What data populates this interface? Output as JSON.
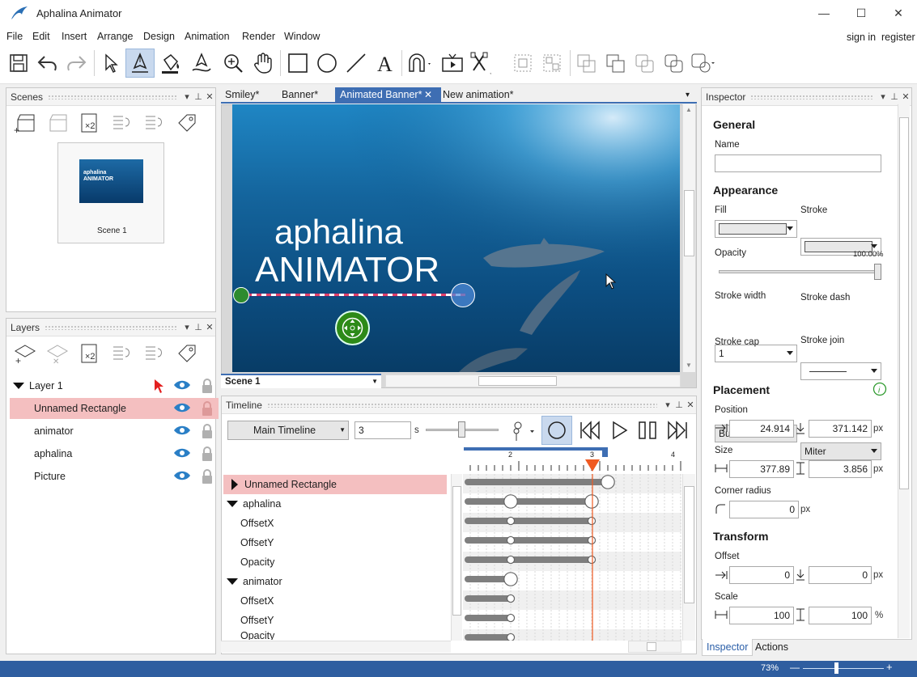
{
  "window": {
    "title": "Aphalina Animator",
    "minimize": "—",
    "maximize": "☐",
    "close": "✕"
  },
  "menu": [
    "File",
    "Edit",
    "Insert",
    "Arrange",
    "Design",
    "Animation",
    "Render",
    "Window"
  ],
  "account": {
    "sign_in": "sign in",
    "register": "register"
  },
  "toolbar": {
    "tools": [
      "save-icon",
      "undo-icon",
      "redo-icon",
      "pointer-icon",
      "pen-tool-icon",
      "fill-bucket-icon",
      "stroke-pen-icon",
      "zoom-icon",
      "hand-icon",
      "rectangle-icon",
      "ellipse-icon",
      "line-icon",
      "text-icon",
      "magnet-icon",
      "preview-icon",
      "tools-icon",
      "group-icon",
      "ungroup-icon",
      "combine-icon",
      "union-icon",
      "intersect-icon",
      "exclude-icon",
      "more-icon"
    ],
    "active": "pen-tool-icon"
  },
  "scenes": {
    "title": "Scenes",
    "thumb_caption": "Scene 1",
    "thumb_text": "aphalina ANIMATOR"
  },
  "layers": {
    "title": "Layers",
    "items": [
      {
        "label": "Layer 1"
      },
      {
        "label": "Unnamed Rectangle"
      },
      {
        "label": "animator"
      },
      {
        "label": "aphalina"
      },
      {
        "label": "Picture"
      }
    ]
  },
  "tabs": [
    "Smiley*",
    "Banner*",
    "Animated Banner*",
    "New animation*"
  ],
  "active_tab": "Animated Banner*",
  "canvas": {
    "text1": "aphalina",
    "text2": "ANIMATOR",
    "scene_select": "Scene 1"
  },
  "timeline": {
    "title": "Timeline",
    "timeline_select": "Main Timeline",
    "duration": "3",
    "duration_unit": "s",
    "ruler": [
      "2",
      "3",
      "4"
    ],
    "tracks": [
      {
        "label": "Unnamed Rectangle"
      },
      {
        "label": "aphalina"
      },
      {
        "label": "OffsetX"
      },
      {
        "label": "OffsetY"
      },
      {
        "label": "Opacity"
      },
      {
        "label": "animator"
      },
      {
        "label": "OffsetX"
      },
      {
        "label": "OffsetY"
      },
      {
        "label": "Opacity"
      }
    ]
  },
  "inspector": {
    "title": "Inspector",
    "general": "General",
    "name_label": "Name",
    "name_value": "",
    "appearance": "Appearance",
    "fill": "Fill",
    "stroke": "Stroke",
    "opacity": "Opacity",
    "opacity_value": "100.00%",
    "stroke_width": "Stroke width",
    "stroke_width_value": "1",
    "stroke_dash": "Stroke dash",
    "stroke_cap": "Stroke cap",
    "stroke_cap_value": "Butt",
    "stroke_join": "Stroke join",
    "stroke_join_value": "Miter",
    "placement": "Placement",
    "position": "Position",
    "pos_x": "24.914",
    "pos_y": "371.142",
    "size": "Size",
    "size_w": "377.89",
    "size_h": "3.856",
    "corner_radius": "Corner radius",
    "corner_value": "0",
    "transform": "Transform",
    "offset": "Offset",
    "offset_x": "0",
    "offset_y": "0",
    "scale": "Scale",
    "scale_x": "100",
    "scale_y": "100",
    "px": "px",
    "pct": "%",
    "tab_inspector": "Inspector",
    "tab_actions": "Actions"
  },
  "status": {
    "zoom": "73%",
    "minus": "—",
    "plus": "+"
  }
}
